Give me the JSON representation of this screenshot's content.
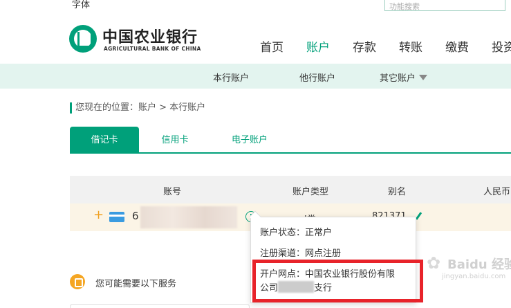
{
  "topbar": {
    "font_label": "字体",
    "search_placeholder": "功能搜索"
  },
  "logo": {
    "cn": "中国农业银行",
    "en": "AGRICULTURAL BANK OF CHINA"
  },
  "main_nav": [
    "首页",
    "账户",
    "存款",
    "转账",
    "缴费",
    "投资"
  ],
  "sub_nav": [
    "本行账户",
    "他行账户",
    "其它账户"
  ],
  "breadcrumb": "您现在的位置：账户 > 本行账户",
  "tabs": [
    "借记卡",
    "信用卡",
    "电子账户"
  ],
  "table": {
    "headers": [
      "账号",
      "账户类型",
      "别名",
      "人民币"
    ],
    "row": {
      "plus": "+",
      "account_prefix": "6",
      "type": "I类",
      "alias": "821371"
    }
  },
  "popup": {
    "status_label": "账户状态：",
    "status_value": "正常户",
    "channel_label": "注册渠道：",
    "channel_value": "网点注册",
    "branch_label": "开户网点：",
    "branch_value_line1": "中国农业银行股份有限",
    "branch_value_line2_prefix": "公司",
    "branch_value_line2_suffix": "支行"
  },
  "services": {
    "label": "您可能需要以下服务"
  },
  "watermark": {
    "text": "Baidu 经验",
    "url": "jingyan.baidu.com"
  },
  "colors": {
    "accent": "#00a07a",
    "highlight": "#e8232a",
    "row_bg": "#fbf4e6",
    "subnav_bg": "#e3f4ef"
  },
  "icons": [
    "card-icon",
    "info-icon",
    "edit-icon",
    "thumbs-up-icon",
    "dropdown-triangle-icon"
  ]
}
